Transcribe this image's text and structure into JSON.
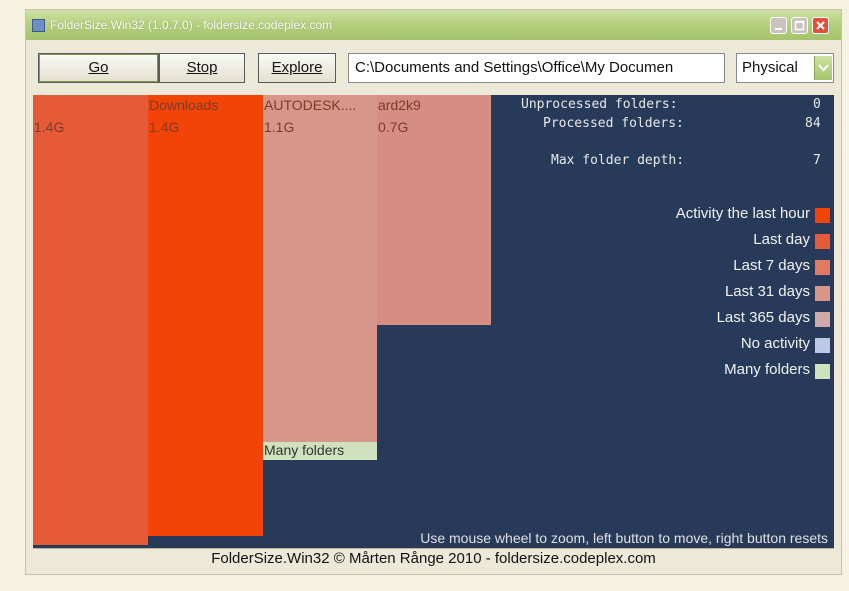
{
  "window": {
    "title": "FolderSize.Win32 (1.0.7.0) - foldersize.codeplex.com"
  },
  "toolbar": {
    "go_label": "Go",
    "stop_label": "Stop",
    "explore_label": "Explore",
    "path_value": "C:\\Documents and Settings\\Office\\My Documen",
    "mode_selected": "Physical"
  },
  "treemap": {
    "blocks": [
      {
        "name": "",
        "size": "1.4G",
        "color": "#e65a38"
      },
      {
        "name": "Downloads",
        "size": "1.4G",
        "color": "#f14406"
      },
      {
        "name": "AUTODESK....",
        "size": "1.1G",
        "color": "#d69689"
      },
      {
        "name": "ard2k9",
        "size": "0.7G",
        "color": "#d68e84"
      }
    ],
    "many_folders_label": "Many folders"
  },
  "stats": {
    "unprocessed_label": "Unprocessed folders:",
    "unprocessed_value": "0",
    "processed_label": "Processed folders:",
    "processed_value": "84",
    "depth_label": "Max folder depth:",
    "depth_value": "7"
  },
  "legend": [
    {
      "label": "Activity the last hour",
      "color": "#f14406"
    },
    {
      "label": "Last day",
      "color": "#e65a38"
    },
    {
      "label": "Last 7 days",
      "color": "#e07a60"
    },
    {
      "label": "Last 31 days",
      "color": "#d69689"
    },
    {
      "label": "Last 365 days",
      "color": "#d0aaa8"
    },
    {
      "label": "No activity",
      "color": "#bcc8e4"
    },
    {
      "label": "Many folders",
      "color": "#cfe1bd"
    }
  ],
  "hint": "Use mouse wheel to zoom, left button to move, right button resets",
  "status": "FolderSize.Win32 © Mårten Rånge 2010 - foldersize.codeplex.com"
}
